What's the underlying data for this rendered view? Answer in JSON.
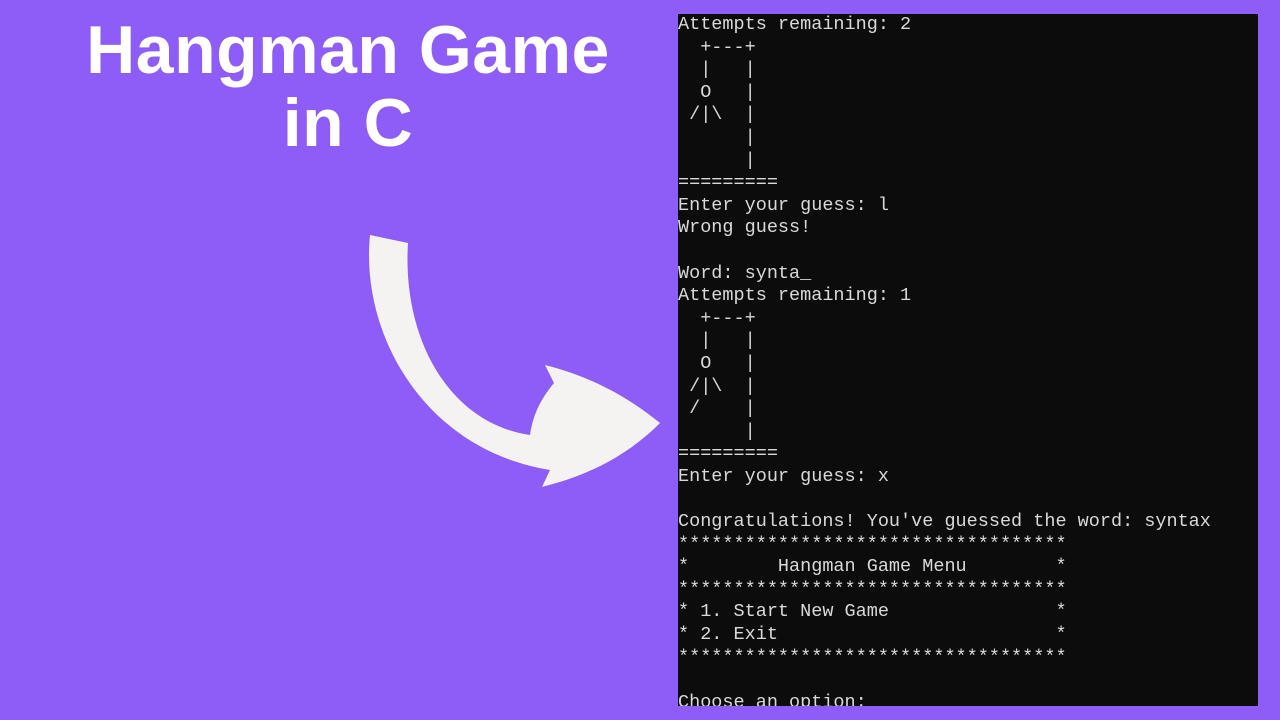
{
  "title": {
    "line1": "Hangman Game",
    "line2": "in C"
  },
  "terminal": {
    "lines": [
      "Attempts remaining: 2",
      "  +---+",
      "  |   |",
      "  O   |",
      " /|\\  |",
      "      |",
      "      |",
      "=========",
      "Enter your guess: l",
      "Wrong guess!",
      "",
      "Word: synta_",
      "Attempts remaining: 1",
      "  +---+",
      "  |   |",
      "  O   |",
      " /|\\  |",
      " /    |",
      "      |",
      "=========",
      "Enter your guess: x",
      "",
      "Congratulations! You've guessed the word: syntax",
      "***********************************",
      "*        Hangman Game Menu        *",
      "***********************************",
      "* 1. Start New Game               *",
      "* 2. Exit                         *",
      "***********************************",
      "",
      "Choose an option:"
    ]
  }
}
